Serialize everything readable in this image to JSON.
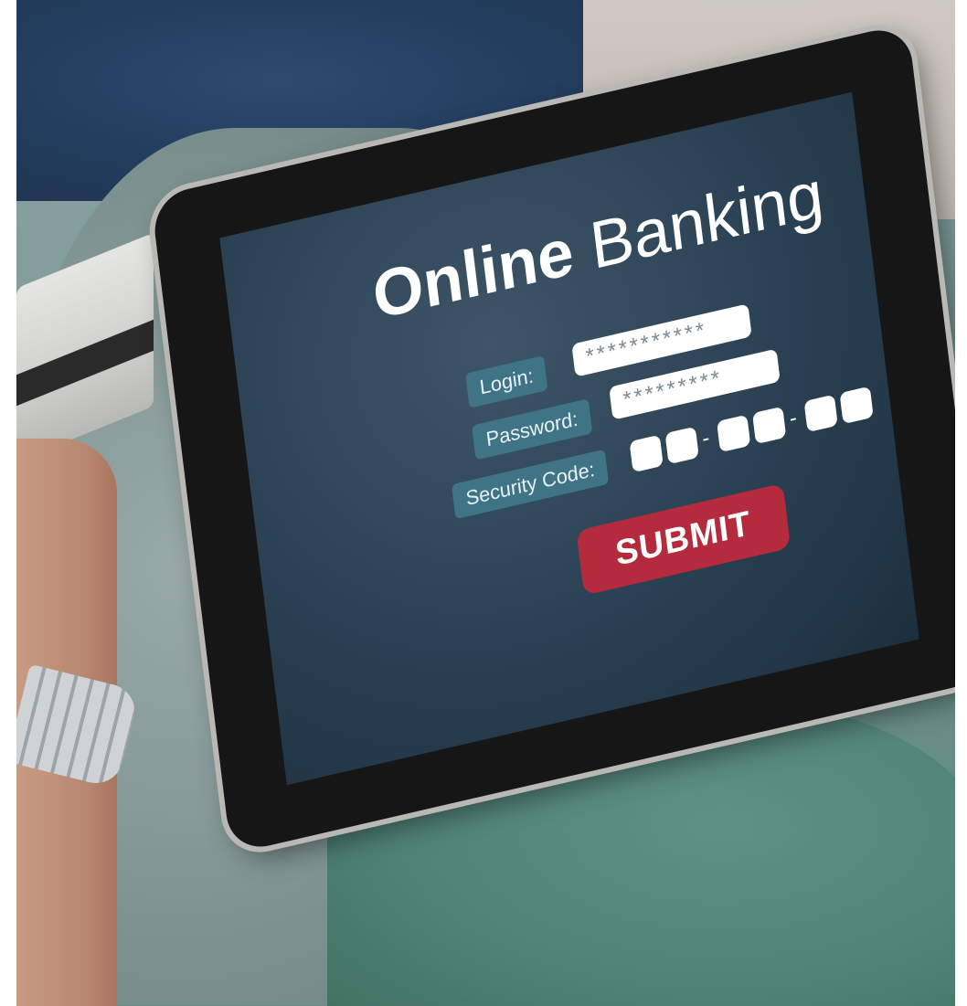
{
  "screen": {
    "title_bold": "Online",
    "title_regular": "Banking",
    "login_label": "Login:",
    "login_value": "***********",
    "password_label": "Password:",
    "password_value": "*********",
    "security_label": "Security Code:",
    "code_separator": "-",
    "submit_label": "SUBMIT"
  }
}
